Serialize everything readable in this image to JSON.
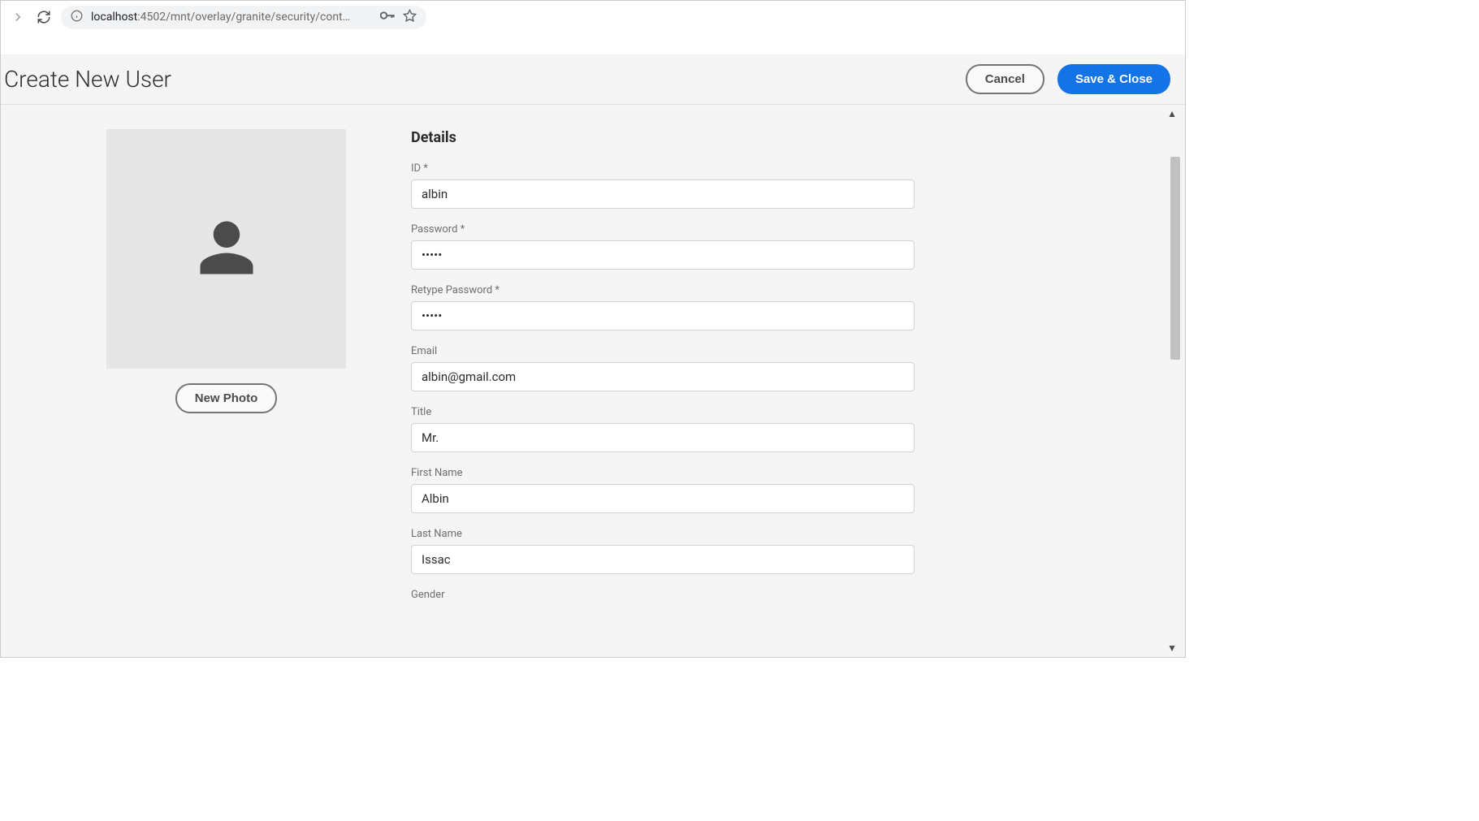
{
  "browser": {
    "url_host": "localhost",
    "url_path": ":4502/mnt/overlay/granite/security/cont…"
  },
  "header": {
    "title": "Create New User",
    "cancel_label": "Cancel",
    "save_label": "Save & Close"
  },
  "photo": {
    "new_photo_label": "New Photo"
  },
  "form": {
    "section_title": "Details",
    "fields": {
      "id": {
        "label": "ID *",
        "value": "albin"
      },
      "password": {
        "label": "Password *",
        "value": "•••••"
      },
      "retype_password": {
        "label": "Retype Password *",
        "value": "•••••"
      },
      "email": {
        "label": "Email",
        "value": "albin@gmail.com"
      },
      "title": {
        "label": "Title",
        "value": "Mr."
      },
      "first_name": {
        "label": "First Name",
        "value": "Albin"
      },
      "last_name": {
        "label": "Last Name",
        "value": "Issac"
      },
      "gender": {
        "label": "Gender",
        "value": ""
      }
    }
  }
}
